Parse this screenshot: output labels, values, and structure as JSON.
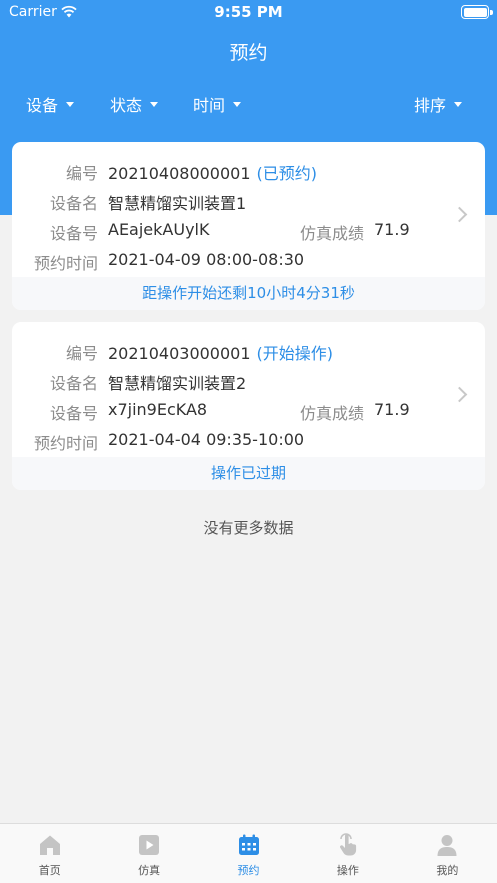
{
  "status_bar": {
    "carrier": "Carrier",
    "time": "9:55 PM"
  },
  "title": "预约",
  "filters": {
    "device": "设备",
    "status": "状态",
    "time": "时间",
    "sort": "排序"
  },
  "labels": {
    "number": "编号",
    "device_name": "设备名",
    "device_no": "设备号",
    "score": "仿真成绩",
    "booking_time": "预约时间"
  },
  "bookings": [
    {
      "number": "20210408000001",
      "status": "(已预约)",
      "device_name": "智慧精馏实训装置1",
      "device_no": "AEajekAUylK",
      "score": "71.9",
      "booking_time": "2021-04-09 08:00-08:30",
      "footer": "距操作开始还剩10小时4分31秒"
    },
    {
      "number": "20210403000001",
      "status": "(开始操作)",
      "device_name": "智慧精馏实训装置2",
      "device_no": "x7jin9EcKA8",
      "score": "71.9",
      "booking_time": "2021-04-04 09:35-10:00",
      "footer": "操作已过期"
    }
  ],
  "no_more": "没有更多数据",
  "tabs": [
    {
      "label": "首页",
      "icon": "home-icon"
    },
    {
      "label": "仿真",
      "icon": "play-icon"
    },
    {
      "label": "预约",
      "icon": "calendar-icon",
      "active": true
    },
    {
      "label": "操作",
      "icon": "hand-pointer-icon"
    },
    {
      "label": "我的",
      "icon": "user-icon"
    }
  ],
  "colors": {
    "primary": "#3a9af2",
    "link": "#2d8ee6",
    "inactive_icon": "#c4c4c4"
  }
}
